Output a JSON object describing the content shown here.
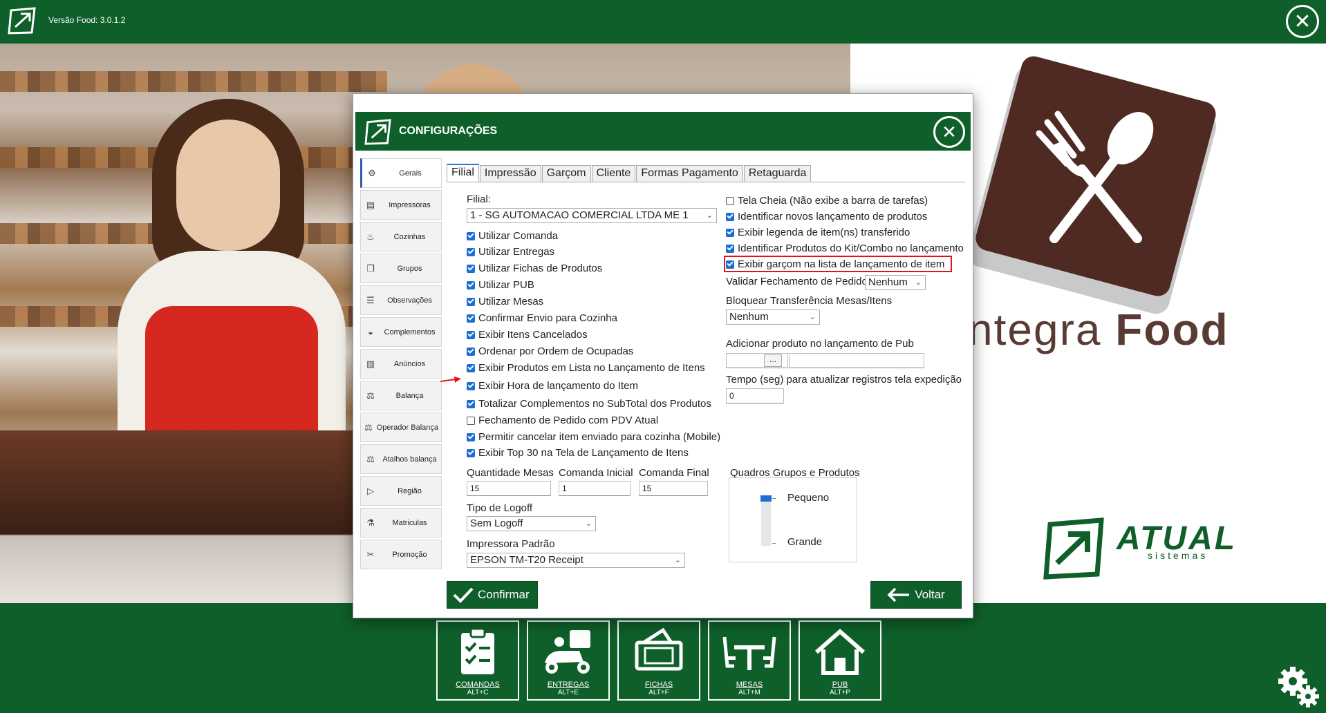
{
  "app": {
    "version": "Versão Food: 3.0.1.2"
  },
  "brand": {
    "name_light": "ntegra ",
    "name_bold": "Food",
    "company": "ATUAL",
    "company_sub": "sistemas"
  },
  "dialog": {
    "title": "CONFIGURAÇÕES",
    "sidebar": [
      {
        "label": "Gerais",
        "icon": "settings-icon"
      },
      {
        "label": "Impressoras",
        "icon": "printer-icon"
      },
      {
        "label": "Cozinhas",
        "icon": "kitchen-icon"
      },
      {
        "label": "Grupos",
        "icon": "groups-icon"
      },
      {
        "label": "Observações",
        "icon": "notes-icon"
      },
      {
        "label": "Complementos",
        "icon": "complements-icon"
      },
      {
        "label": "Anúncios",
        "icon": "ads-icon"
      },
      {
        "label": "Balança",
        "icon": "scale-icon"
      },
      {
        "label": "Operador Balança",
        "icon": "scale-operator-icon"
      },
      {
        "label": "Atalhos balança",
        "icon": "scale-shortcut-icon"
      },
      {
        "label": "Região",
        "icon": "region-icon"
      },
      {
        "label": "Matriculas",
        "icon": "registration-icon"
      },
      {
        "label": "Promoção",
        "icon": "promotion-icon"
      }
    ],
    "tabs": [
      "Filial",
      "Impressão",
      "Garçom",
      "Cliente",
      "Formas Pagamento",
      "Retaguarda"
    ],
    "left": {
      "filial_label": "Filial:",
      "filial_value": "1 - SG AUTOMACAO COMERCIAL LTDA ME 1",
      "checkboxes": [
        {
          "label": "Utilizar Comanda",
          "checked": true
        },
        {
          "label": "Utilizar Entregas",
          "checked": true
        },
        {
          "label": "Utilizar Fichas de Produtos",
          "checked": true
        },
        {
          "label": "Utilizar PUB",
          "checked": true
        },
        {
          "label": "Utilizar Mesas",
          "checked": true
        },
        {
          "label": "Confirmar Envio para Cozinha",
          "checked": true
        },
        {
          "label": "Exibir Itens Cancelados",
          "checked": true
        },
        {
          "label": "Ordenar por Ordem de Ocupadas",
          "checked": true
        },
        {
          "label": "Exibir Produtos em Lista no Lançamento de Itens",
          "checked": true
        },
        {
          "label": "Exibir Hora de lançamento do Item",
          "checked": true
        },
        {
          "label": "Totalizar Complementos no SubTotal dos Produtos",
          "checked": true
        },
        {
          "label": "Fechamento de Pedido com PDV Atual",
          "checked": false
        },
        {
          "label": "Permitir cancelar item enviado para cozinha (Mobile)",
          "checked": true
        },
        {
          "label": "Exibir Top 30 na Tela de Lançamento de Itens",
          "checked": true
        }
      ],
      "qtd_mesas_label": "Quantidade Mesas",
      "qtd_mesas_value": "15",
      "comanda_inicial_label": "Comanda Inicial",
      "comanda_inicial_value": "1",
      "comanda_final_label": "Comanda Final",
      "comanda_final_value": "15",
      "logoff_label": "Tipo de Logoff",
      "logoff_value": "Sem Logoff",
      "impressora_label": "Impressora Padrão",
      "impressora_value": "EPSON TM-T20 Receipt"
    },
    "right": {
      "checkboxes": [
        {
          "label": "Tela Cheia (Não exibe a barra de tarefas)",
          "checked": false
        },
        {
          "label": "Identificar novos lançamento de produtos",
          "checked": true
        },
        {
          "label": "Exibir legenda de item(ns) transferido",
          "checked": true
        },
        {
          "label": "Identificar Produtos do Kit/Combo no lançamento",
          "checked": true
        },
        {
          "label": "Exibir garçom na lista de lançamento de item",
          "checked": true
        }
      ],
      "validar_label": "Validar Fechamento de Pedido",
      "validar_value": "Nenhum",
      "bloquear_label": "Bloquear Transferência Mesas/Itens",
      "bloquear_value": "Nenhum",
      "adicionar_label": "Adicionar produto no lançamento de Pub",
      "browse_label": "...",
      "tempo_label": "Tempo (seg) para atualizar registros tela expedição",
      "tempo_value": "0",
      "quadros_label": "Quadros Grupos e Produtos",
      "size_small": "Pequeno",
      "size_large": "Grande"
    },
    "confirm_label": "Confirmar",
    "back_label": "Voltar"
  },
  "bottom_nav": [
    {
      "label": "COMANDAS",
      "shortcut": "ALT+C",
      "icon": "clipboard-icon"
    },
    {
      "label": "ENTREGAS",
      "shortcut": "ALT+E",
      "icon": "scooter-icon"
    },
    {
      "label": "FICHAS",
      "shortcut": "ALT+F",
      "icon": "ticket-icon"
    },
    {
      "label": "MESAS",
      "shortcut": "ALT+M",
      "icon": "table-icon"
    },
    {
      "label": "PUB",
      "shortcut": "ALT+P",
      "icon": "home-icon"
    }
  ],
  "colors": {
    "brand_green": "#0e5f2a",
    "accent_blue": "#1a6fd4",
    "highlight_red": "#e2141a",
    "brand_brown": "#4f2a22"
  }
}
